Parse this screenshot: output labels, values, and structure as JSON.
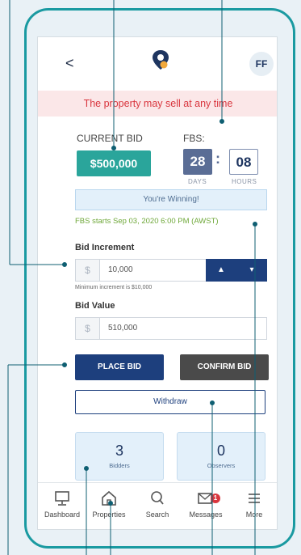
{
  "header": {
    "back_label": "<",
    "avatar_initials": "FF"
  },
  "alert": {
    "text": "The property may sell at any time"
  },
  "current_bid": {
    "label": "CURRENT BID",
    "value": "$500,000"
  },
  "fbs": {
    "label": "FBS:",
    "days_value": "28",
    "hours_value": "08",
    "separator": ":",
    "days_label": "DAYS",
    "hours_label": "HOURS",
    "status": "You're Winning!",
    "starts_text": "FBS starts Sep 03, 2020 6:00 PM (AWST)"
  },
  "bid_increment": {
    "label": "Bid Increment",
    "currency": "$",
    "value": "10,000",
    "up_label": "▲",
    "down_label": "▾",
    "hint": "Minimum increment is $10,000"
  },
  "bid_value": {
    "label": "Bid Value",
    "currency": "$",
    "value": "510,000"
  },
  "actions": {
    "place_bid": "PLACE BID",
    "confirm_bid": "CONFIRM BID",
    "withdraw": "Withdraw"
  },
  "stats": [
    {
      "value": "3",
      "label": "Bidders"
    },
    {
      "value": "0",
      "label": "Observers"
    }
  ],
  "nav": [
    {
      "label": "Dashboard",
      "icon": "monitor-icon"
    },
    {
      "label": "Properties",
      "icon": "home-icon"
    },
    {
      "label": "Search",
      "icon": "search-icon"
    },
    {
      "label": "Messages",
      "icon": "mail-icon",
      "badge": "1"
    },
    {
      "label": "More",
      "icon": "menu-icon"
    }
  ],
  "colors": {
    "frame": "#1a9aa1",
    "bid_green": "#2aa59b",
    "navy": "#1d3f7d",
    "alert_red": "#d9363e",
    "fbs_green": "#6fa83a",
    "slate": "#5a6d95"
  }
}
